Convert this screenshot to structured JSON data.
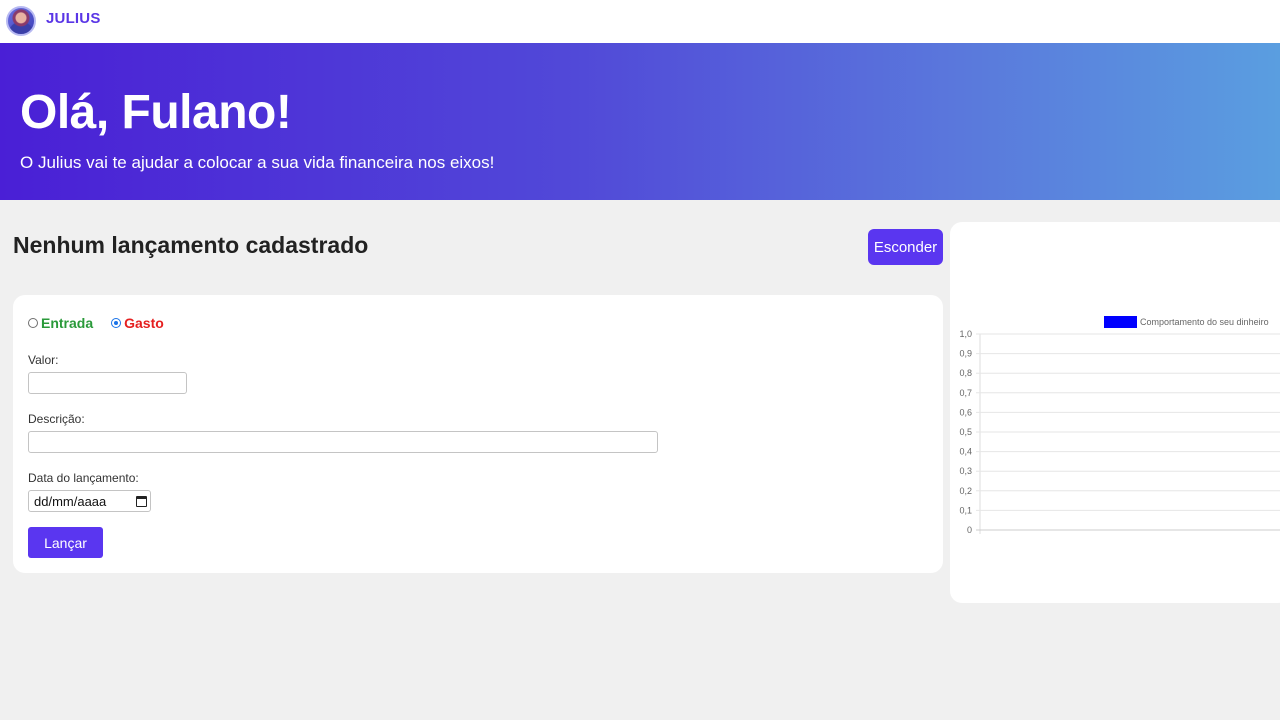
{
  "header": {
    "brand": "JULIUS"
  },
  "hero": {
    "title": "Olá, Fulano!",
    "subtitle": "O Julius vai te ajudar a colocar a sua vida financeira nos eixos!"
  },
  "main": {
    "empty_title": "Nenhum lançamento cadastrado",
    "hide_button": "Esconder"
  },
  "form": {
    "type_options": [
      {
        "label": "Entrada",
        "checked": false
      },
      {
        "label": "Gasto",
        "checked": true
      }
    ],
    "value_label": "Valor:",
    "value_input": "",
    "description_label": "Descrição:",
    "description_input": "",
    "date_label": "Data do lançamento:",
    "date_placeholder": "dd/mm/aaaa",
    "submit_label": "Lançar"
  },
  "chart_data": {
    "type": "bar",
    "categories": [],
    "series": [
      {
        "name": "Comportamento do seu dinheiro",
        "values": [],
        "color": "#0000ff"
      }
    ],
    "ylim": [
      0,
      1
    ],
    "yticks": [
      "1,0",
      "0,9",
      "0,8",
      "0,7",
      "0,6",
      "0,5",
      "0,4",
      "0,3",
      "0,2",
      "0,1",
      "0"
    ],
    "legend_position": "top",
    "grid": true
  },
  "colors": {
    "accent": "#5a36f0",
    "income": "#2a9a3a",
    "expense": "#e52020"
  }
}
